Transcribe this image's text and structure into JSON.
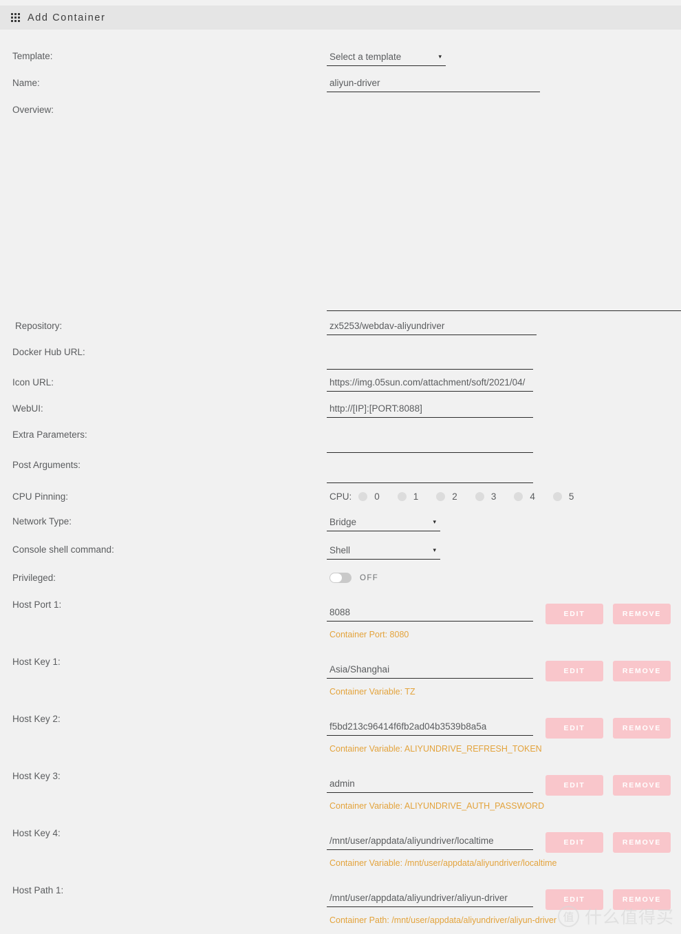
{
  "window": {
    "title": "Add Container",
    "icon": "grid-icon"
  },
  "form": {
    "template": {
      "label": "Template:",
      "value": "Select a template",
      "caret": "▾"
    },
    "name": {
      "label": "Name:",
      "value": "aliyun-driver"
    },
    "overview": {
      "label": "Overview:",
      "value": ""
    },
    "repository": {
      "label": "Repository:",
      "value": "zx5253/webdav-aliyundriver"
    },
    "docker_hub_url": {
      "label": "Docker Hub URL:",
      "value": ""
    },
    "icon_url": {
      "label": "Icon URL:",
      "value": "https://img.05sun.com/attachment/soft/2021/04/"
    },
    "webui": {
      "label": "WebUI:",
      "value": "http://[IP]:[PORT:8088]"
    },
    "extra_parameters": {
      "label": "Extra Parameters:",
      "value": ""
    },
    "post_arguments": {
      "label": "Post Arguments:",
      "value": ""
    },
    "cpu_pinning": {
      "label": "CPU Pinning:",
      "prefix": "CPU:",
      "cores": [
        "0",
        "1",
        "2",
        "3",
        "4",
        "5"
      ]
    },
    "network_type": {
      "label": "Network Type:",
      "value": "Bridge",
      "caret": "▾"
    },
    "console_shell": {
      "label": "Console shell command:",
      "value": "Shell",
      "caret": "▾"
    },
    "privileged": {
      "label": "Privileged:",
      "state": "OFF"
    }
  },
  "buttons": {
    "edit": "EDIT",
    "remove": "REMOVE"
  },
  "entries": [
    {
      "label": "Host Port 1:",
      "value": "8088",
      "hint": "Container Port: 8080"
    },
    {
      "label": "Host Key 1:",
      "value": "Asia/Shanghai",
      "hint": "Container Variable: TZ"
    },
    {
      "label": "Host Key 2:",
      "value": "f5bd213c96414f6fb2ad04b3539b8a5a",
      "hint": "Container Variable: ALIYUNDRIVE_REFRESH_TOKEN"
    },
    {
      "label": "Host Key 3:",
      "value": "admin",
      "hint": "Container Variable: ALIYUNDRIVE_AUTH_PASSWORD"
    },
    {
      "label": "Host Key 4:",
      "value": "/mnt/user/appdata/aliyundriver/localtime",
      "hint": "Container Variable: /mnt/user/appdata/aliyundriver/localtime"
    },
    {
      "label": "Host Path 1:",
      "value": "/mnt/user/appdata/aliyundriver/aliyun-driver",
      "hint": "Container Path: /mnt/user/appdata/aliyundriver/aliyun-driver"
    }
  ],
  "watermark": {
    "mark": "值",
    "text": "什么值得买"
  },
  "colors": {
    "page_bg": "#f1f1f1",
    "titlebar_bg": "#e5e5e5",
    "button_pink": "#f9c6cb",
    "hint_orange": "#e3a33c",
    "underline": "#2b2b2b"
  }
}
